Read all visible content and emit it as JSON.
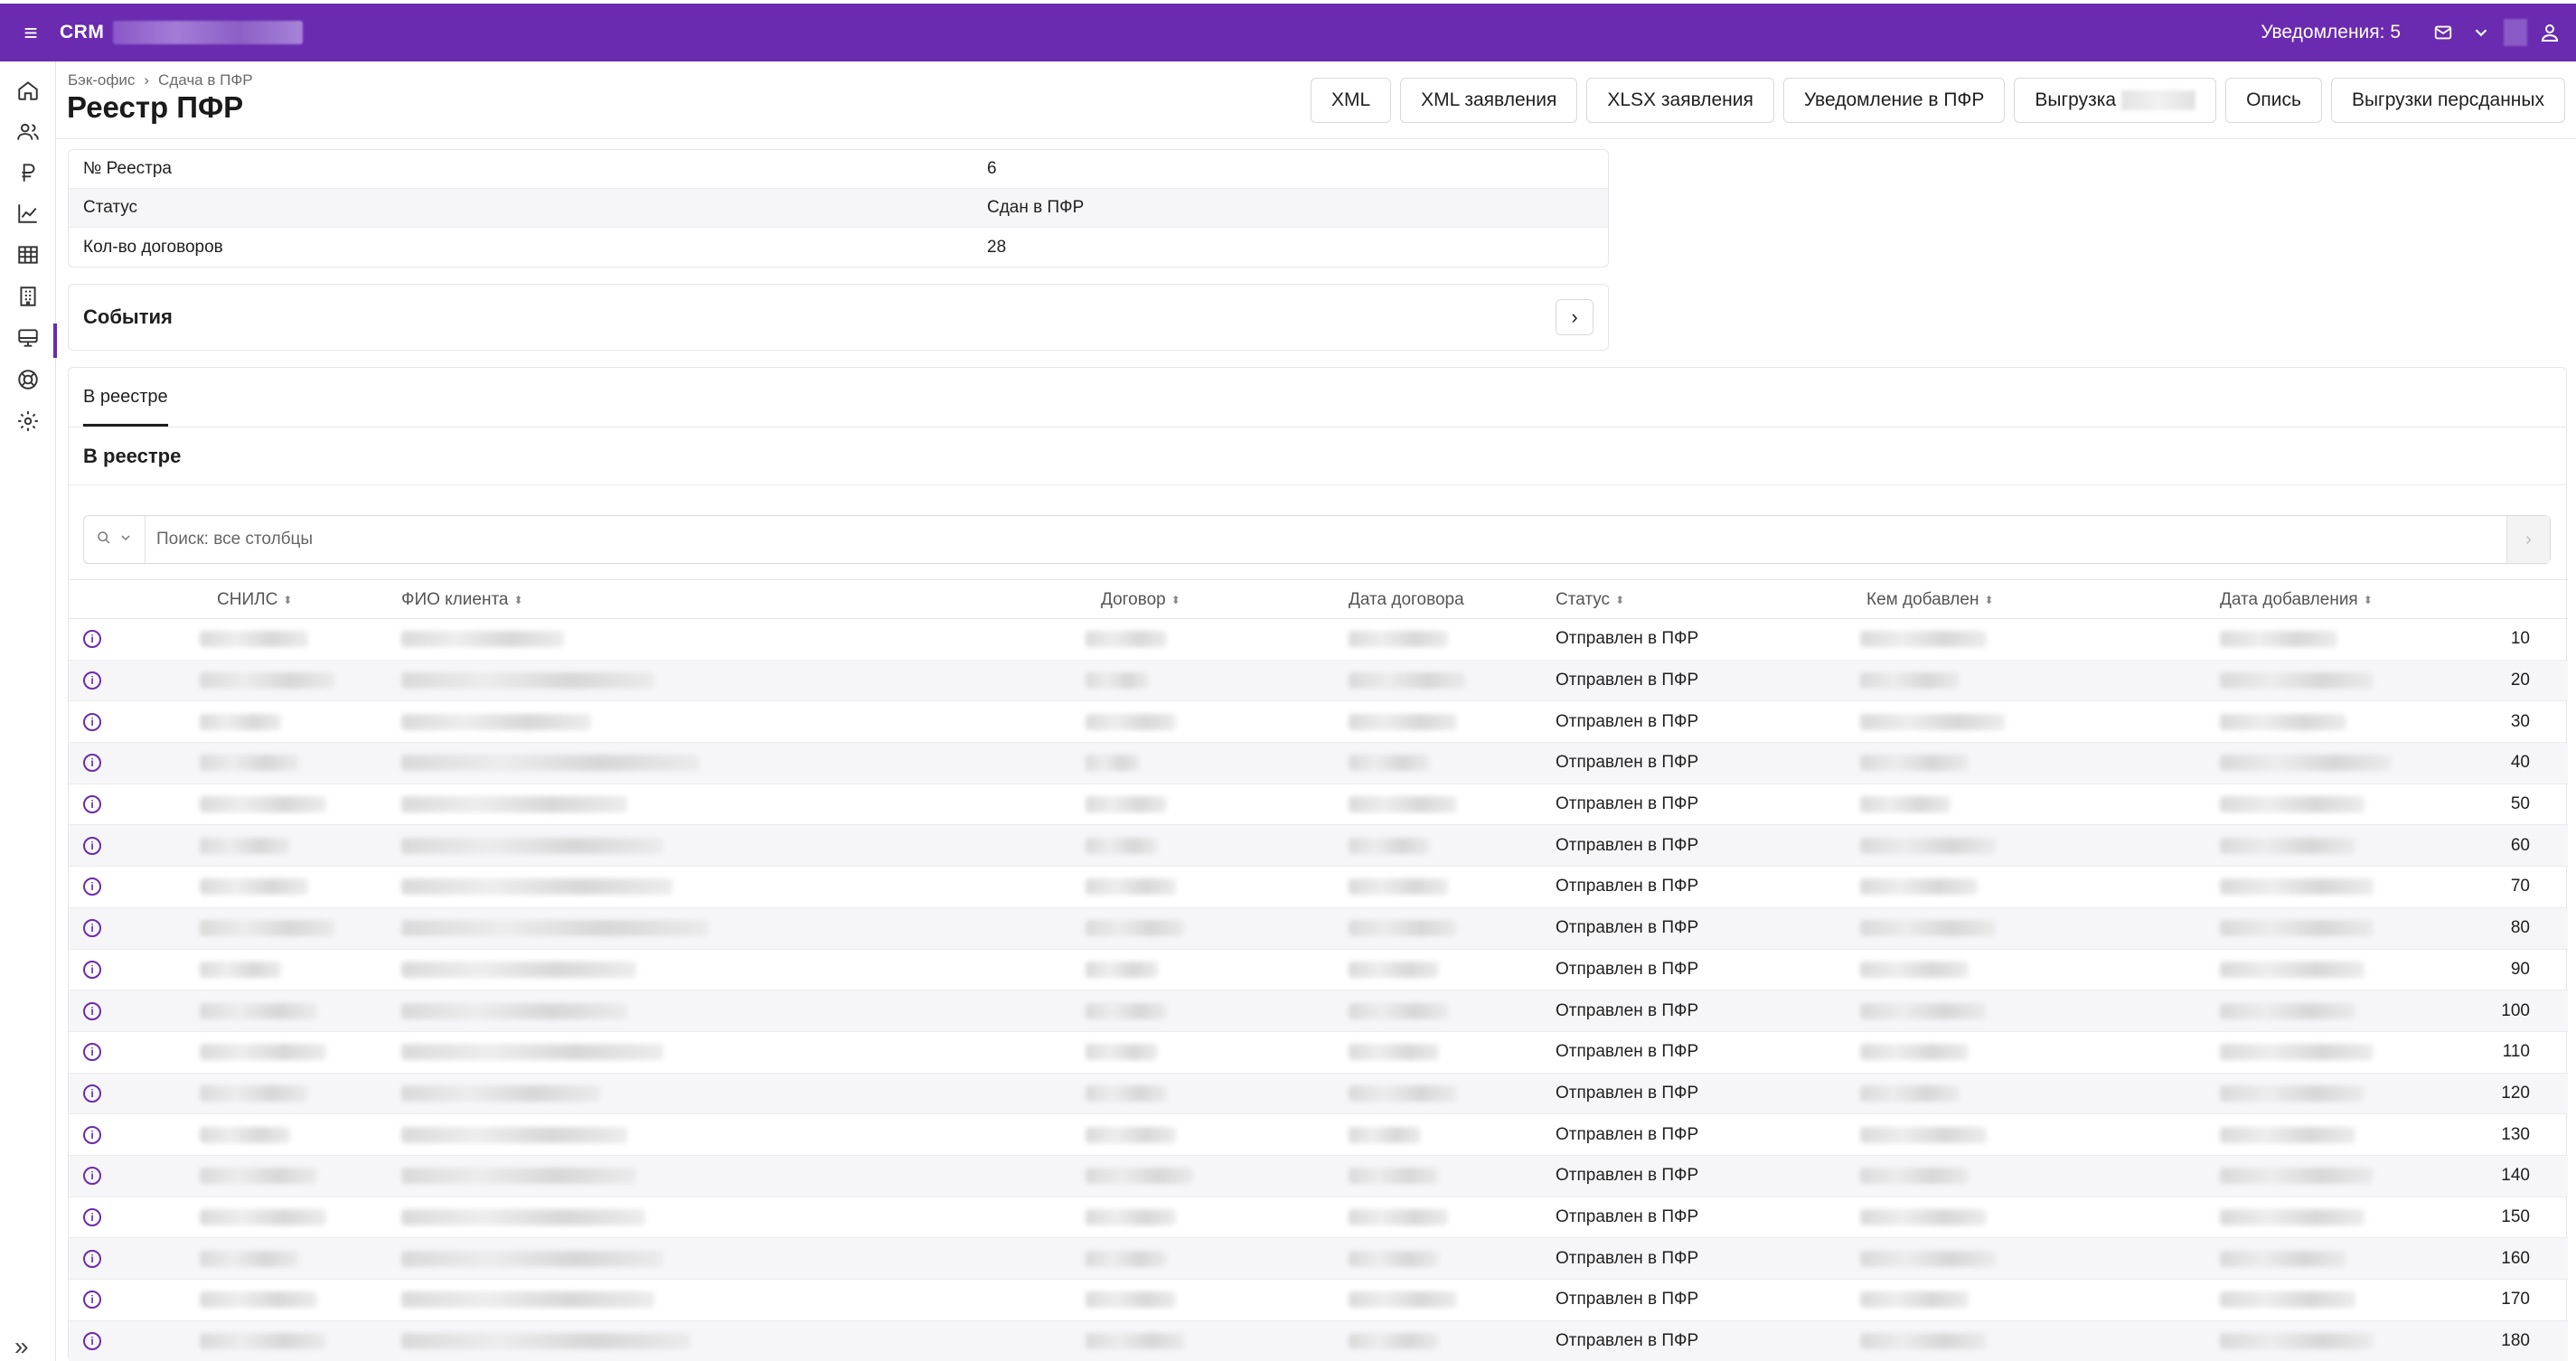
{
  "app": {
    "brand": "CRM",
    "notifications_label": "Уведомления: 5"
  },
  "breadcrumb": [
    "Бэк-офис",
    "Сдача в ПФР"
  ],
  "page_title": "Реестр ПФР",
  "actions": {
    "xml": "XML",
    "xml_apps": "XML заявления",
    "xlsx_apps": "XLSX заявления",
    "notify_pfr": "Уведомление в ПФР",
    "upload": "Выгрузка",
    "inventory": "Опись",
    "persdata": "Выгрузки персданных"
  },
  "info": [
    {
      "key": "№ Реестра",
      "value": "6"
    },
    {
      "key": "Статус",
      "value": "Сдан в ПФР"
    },
    {
      "key": "Кол-во договоров",
      "value": "28"
    }
  ],
  "events_title": "События",
  "tabs": [
    "В реестре"
  ],
  "section_title": "В реестре",
  "search": {
    "placeholder": "Поиск: все столбцы"
  },
  "columns": {
    "snils": "СНИЛС",
    "fio": "ФИО клиента",
    "contract": "Договор",
    "contract_date": "Дата договора",
    "status": "Статус",
    "added_by": "Кем добавлен",
    "added_date": "Дата добавления"
  },
  "rows": [
    {
      "status": "Отправлен в ПФР",
      "num": "10"
    },
    {
      "status": "Отправлен в ПФР",
      "num": "20"
    },
    {
      "status": "Отправлен в ПФР",
      "num": "30"
    },
    {
      "status": "Отправлен в ПФР",
      "num": "40"
    },
    {
      "status": "Отправлен в ПФР",
      "num": "50"
    },
    {
      "status": "Отправлен в ПФР",
      "num": "60"
    },
    {
      "status": "Отправлен в ПФР",
      "num": "70"
    },
    {
      "status": "Отправлен в ПФР",
      "num": "80"
    },
    {
      "status": "Отправлен в ПФР",
      "num": "90"
    },
    {
      "status": "Отправлен в ПФР",
      "num": "100"
    },
    {
      "status": "Отправлен в ПФР",
      "num": "110"
    },
    {
      "status": "Отправлен в ПФР",
      "num": "120"
    },
    {
      "status": "Отправлен в ПФР",
      "num": "130"
    },
    {
      "status": "Отправлен в ПФР",
      "num": "140"
    },
    {
      "status": "Отправлен в ПФР",
      "num": "150"
    },
    {
      "status": "Отправлен в ПФР",
      "num": "160"
    },
    {
      "status": "Отправлен в ПФР",
      "num": "170"
    },
    {
      "status": "Отправлен в ПФР",
      "num": "180"
    }
  ],
  "colors": {
    "brand": "#6a2bb0",
    "row_alt": "#f6f6f9"
  }
}
